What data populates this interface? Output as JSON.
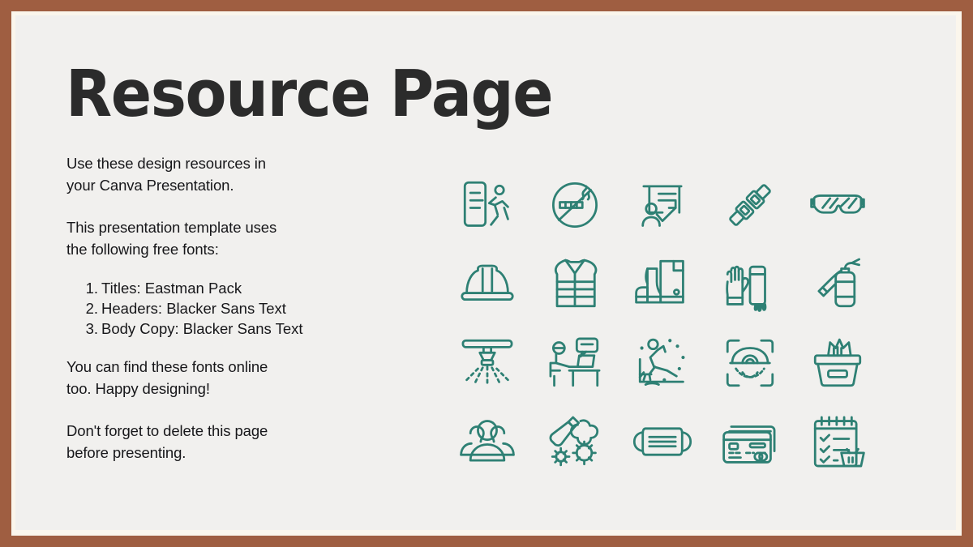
{
  "slide": {
    "title": "Resource Page",
    "frame_color": "#9F5E41",
    "frame_line_color": "#FBF6EC",
    "panel_color": "#F1F0EE",
    "title_color": "#2B2B2B",
    "body_color": "#17171A",
    "icon_color": "#2E8074"
  },
  "body": {
    "intro_line1": "Use these design resources in",
    "intro_line2": "your Canva Presentation.",
    "fonts_intro_line1": "This presentation template uses",
    "fonts_intro_line2": "the following free fonts:",
    "font_list": [
      {
        "num": "1.",
        "label": "Titles: Eastman Pack"
      },
      {
        "num": "2.",
        "label": "Headers: Blacker Sans Text"
      },
      {
        "num": "3.",
        "label": "Body Copy: Blacker Sans Text"
      }
    ],
    "find_line1": "You can find these fonts online",
    "find_line2": "too. Happy designing!",
    "delete_line1": "Don't forget to delete this page",
    "delete_line2": "before presenting."
  },
  "icon_grid": {
    "columns": 5,
    "rows": 4,
    "icons": [
      "emergency-evacuation-plan-icon",
      "no-smoking-icon",
      "safety-training-presentation-icon",
      "seatbelt-icon",
      "safety-goggles-icon",
      "hard-hat-icon",
      "safety-vest-icon",
      "safety-boots-icon",
      "protective-gloves-icon",
      "fire-extinguisher-icon",
      "fire-sprinkler-icon",
      "office-ergonomics-icon",
      "slip-and-fall-hazard-icon",
      "eye-scan-icon",
      "wet-wipes-container-icon",
      "group-of-people-icon",
      "sanitizer-germs-icon",
      "face-mask-icon",
      "credit-cards-icon",
      "shopping-checklist-icon"
    ]
  }
}
